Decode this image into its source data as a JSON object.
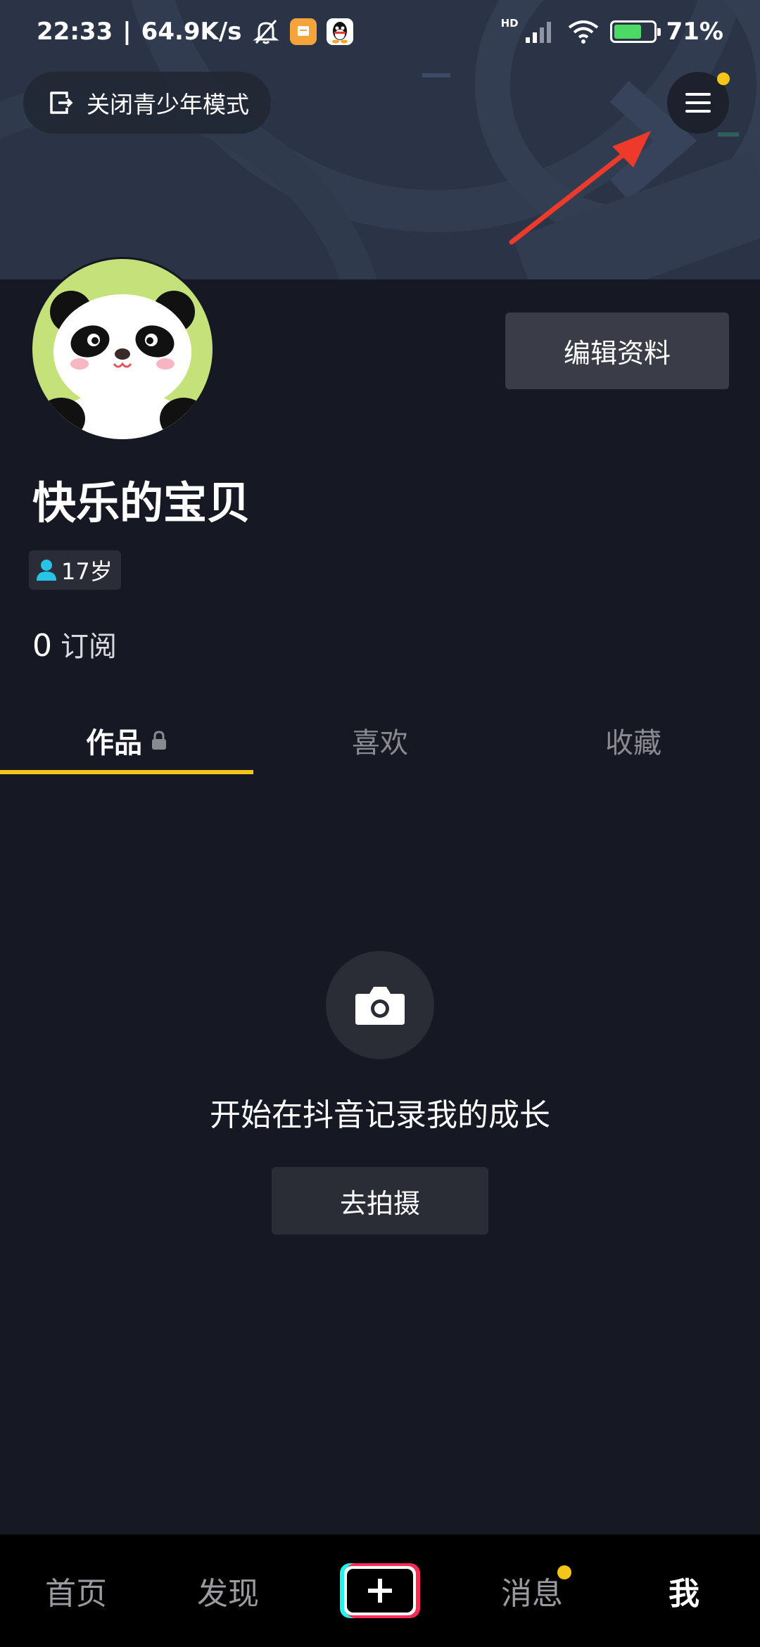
{
  "status_bar": {
    "time": "22:33",
    "network_speed": "64.9K/s",
    "separator": "|",
    "hd": "HD",
    "battery": "71%",
    "battery_level": 0.71
  },
  "header": {
    "teen_mode_label": "关闭青少年模式"
  },
  "profile": {
    "edit_button": "编辑资料",
    "nickname": "快乐的宝贝",
    "age_badge": "17岁",
    "subscriptions_count": "0",
    "subscriptions_label": "订阅"
  },
  "tabs": [
    {
      "label": "作品",
      "active": true,
      "locked": true
    },
    {
      "label": "喜欢",
      "active": false
    },
    {
      "label": "收藏",
      "active": false
    }
  ],
  "empty_state": {
    "text": "开始在抖音记录我的成长",
    "button": "去拍摄"
  },
  "bottom_nav": {
    "home": "首页",
    "discover": "发现",
    "messages": "消息",
    "me": "我"
  },
  "colors": {
    "background": "#161823",
    "accent_yellow": "#f5c518",
    "arrow_red": "#ee3a2a",
    "tiktok_cyan": "#25f4ee",
    "tiktok_red": "#fe2c55"
  }
}
